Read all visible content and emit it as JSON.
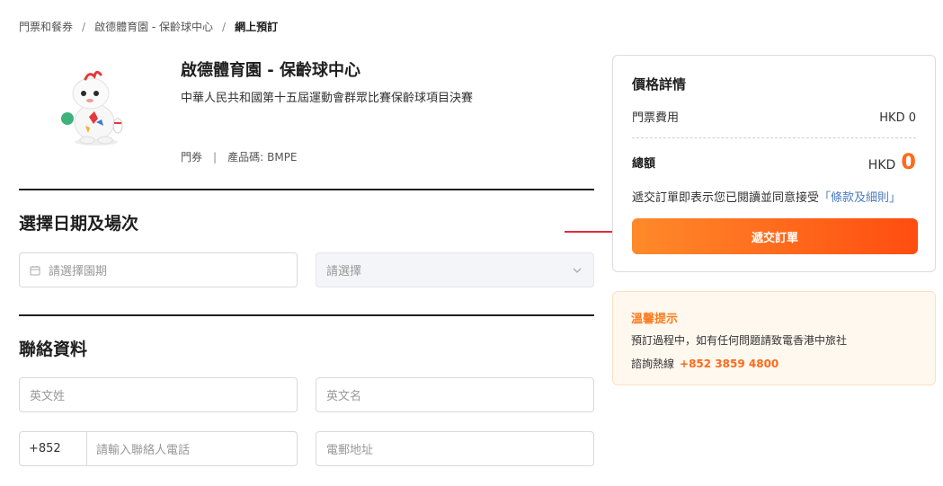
{
  "breadcrumb": {
    "items": [
      "門票和餐券",
      "啟德體育園 - 保齡球中心"
    ],
    "current": "網上預訂",
    "separator": "/"
  },
  "product": {
    "title": "啟德體育園 - 保齡球中心",
    "subtitle": "中華人民共和國第十五屆運動會群眾比賽保齡球項目決賽",
    "type": "門券",
    "meta_divider": "|",
    "code_label": "產品碼:",
    "code": "BMPE"
  },
  "date_section": {
    "title": "選擇日期及場次",
    "date_placeholder": "請選擇園期",
    "session_placeholder": "請選擇"
  },
  "contact_section": {
    "title": "聯絡資料",
    "last_name_placeholder": "英文姓",
    "first_name_placeholder": "英文名",
    "phone_prefix": "+852",
    "phone_placeholder": "請輸入聯絡人電話",
    "email_placeholder": "電郵地址"
  },
  "price": {
    "title": "價格詳情",
    "ticket_label": "門票費用",
    "ticket_value": "HKD 0",
    "total_label": "總額",
    "total_currency": "HKD",
    "total_amount": "0",
    "terms_text": "遞交訂單即表示您已閱讀並同意接受",
    "terms_link": "「條款及細則」",
    "submit_label": "遞交訂單"
  },
  "tip": {
    "title": "溫馨提示",
    "line": "預訂過程中，如有任何問題請致電香港中旅社",
    "hotline_label": "諮詢熱線",
    "hotline": "+852 3859 4800"
  },
  "colors": {
    "accent": "#ff6a1a",
    "arrow": "#e3293b",
    "link": "#4a7bbf"
  },
  "icons": [
    "calendar-icon",
    "chevron-down-icon",
    "mascot-image",
    "arrow-annotation"
  ]
}
